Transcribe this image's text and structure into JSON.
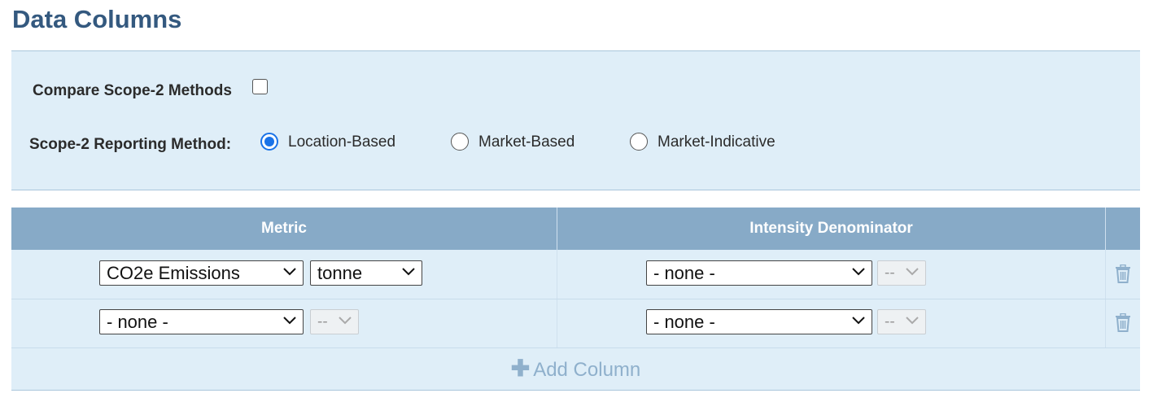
{
  "page": {
    "title": "Data Columns"
  },
  "options": {
    "compare_label": "Compare Scope-2 Methods",
    "compare_checked": false,
    "method_label": "Scope-2 Reporting Method:",
    "methods": [
      {
        "label": "Location-Based",
        "selected": true
      },
      {
        "label": "Market-Based",
        "selected": false
      },
      {
        "label": "Market-Indicative",
        "selected": false
      }
    ]
  },
  "table": {
    "headers": {
      "metric": "Metric",
      "denominator": "Intensity Denominator"
    },
    "rows": [
      {
        "metric": "CO2e Emissions",
        "unit": "tonne",
        "unit_disabled": false,
        "denominator": "- none -",
        "denominator_unit": "--"
      },
      {
        "metric": "- none -",
        "unit": "--",
        "unit_disabled": true,
        "denominator": "- none -",
        "denominator_unit": "--"
      }
    ],
    "add_column_label": "Add Column"
  },
  "colors": {
    "title": "#34597f",
    "panel_bg": "#dfeef8",
    "header_bg": "#87aac7",
    "radio_accent": "#1a73e8",
    "add_link": "#8fb0cc"
  },
  "icons": {
    "checkbox": "checkbox-icon",
    "chevron": "chevron-down-icon",
    "delete": "trash-icon",
    "add": "plus-icon"
  }
}
